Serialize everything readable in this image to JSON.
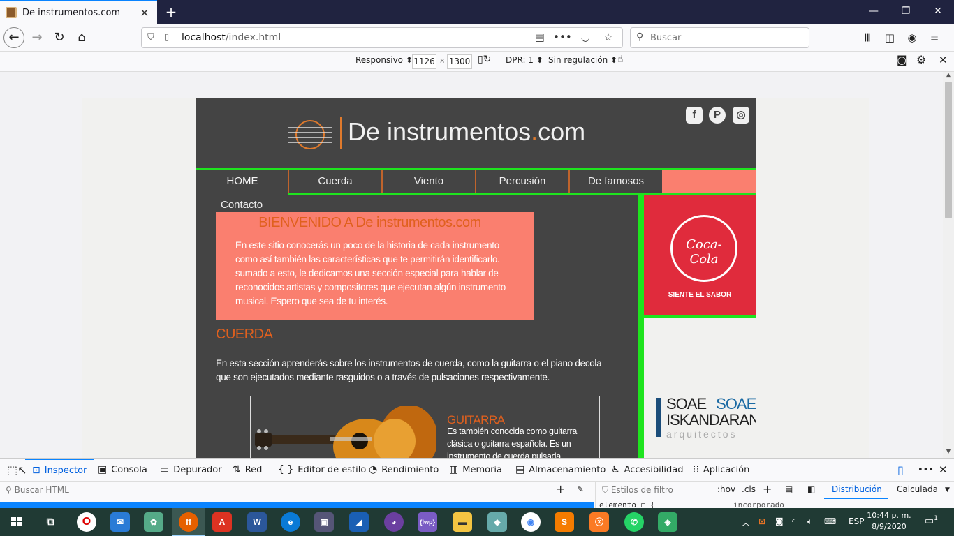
{
  "browser": {
    "tab_title": "De instrumentos.com",
    "url_host": "localhost",
    "url_path": "/index.html",
    "search_placeholder": "Buscar"
  },
  "rdm": {
    "device": "Responsivo",
    "width": "1126",
    "times": "×",
    "height": "1300",
    "dpr": "DPR: 1",
    "throttle": "Sin regulación"
  },
  "site": {
    "logo_main": "De instrumentos",
    "logo_dot": ".",
    "logo_tld": "com",
    "social": [
      "facebook-icon",
      "pinterest-icon",
      "instagram-icon"
    ],
    "menu": [
      "HOME",
      "Cuerda",
      "Viento",
      "Percusión",
      "De famosos",
      "Contacto"
    ],
    "welcome_title": "BIENVENIDO A De instrumentos.com",
    "welcome_text": "En este sitio conocerás un poco de la historia de cada instrumento como así también las características que te permitirán identificarlo. sumado a esto, le dedicamos una sección especial para hablar de reconocidos artistas y compositores que ejecutan algún instrumento musical. Espero que sea de tu interés.",
    "section_title": "CUERDA",
    "section_text": "En esta sección aprenderás sobre los instrumentos de cuerda, como la guitarra o el piano decola que son ejecutados mediante rasguidos o a través de pulsaciones respectivamente.",
    "card_title": "GUITARRA",
    "card_text": "Es también conocida como guitarra clásica o guitarra española. Es un instrumento de cuerda pulsada",
    "ad1_brand": "Coca-Cola",
    "ad1_tagline": "SIENTE EL SABOR",
    "ad2_line1a": "SOAE",
    "ad2_line1b": "SOAE",
    "ad2_line2": "ISKANDARANI",
    "ad2_line3": "arquitectos"
  },
  "devtools": {
    "tabs": [
      "Inspector",
      "Consola",
      "Depurador",
      "Red",
      "Editor de estilo",
      "Rendimiento",
      "Memoria",
      "Almacenamiento",
      "Accesibilidad",
      "Aplicación"
    ],
    "search_html": "Buscar HTML",
    "styles_filter": "Estilos de filtro",
    "hov": ":hov",
    "cls": ".cls",
    "distribucion": "Distribución",
    "calculada": "Calculada",
    "code_element": "elemento ◻ {",
    "code_incorporado": "incorporado"
  },
  "taskbar": {
    "lang": "ESP",
    "time": "10:44 p. m.",
    "date": "8/9/2020",
    "notifications": "1"
  },
  "colors": {
    "accent_green": "#1ee41e",
    "salmon": "#fa7f6f",
    "orange": "#e0601e",
    "site_bg": "#444444"
  }
}
